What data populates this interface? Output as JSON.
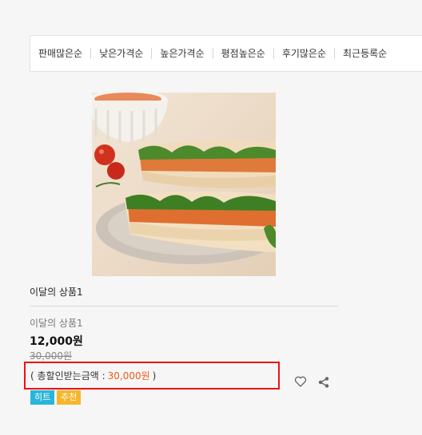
{
  "sort_options": [
    "판매많은순",
    "낮은가격순",
    "높은가격순",
    "평점높은순",
    "후기많은순",
    "최근등록순"
  ],
  "product": {
    "name": "이달의 상품1",
    "subtitle": "이달의 상품1",
    "price": "12,000원",
    "original_price": "30,000원",
    "discount_prefix": "( 총할인받는금액 :",
    "discount_amount": "30,000원",
    "discount_suffix": ")",
    "tags": [
      "히트",
      "추천"
    ]
  },
  "icons": {
    "wish": "heart-icon",
    "share": "share-icon"
  },
  "colors": {
    "discount": "#f05a1a",
    "tag_hit": "#28b6d9",
    "tag_recommend": "#f6b62d",
    "highlight": "#ee1111"
  }
}
